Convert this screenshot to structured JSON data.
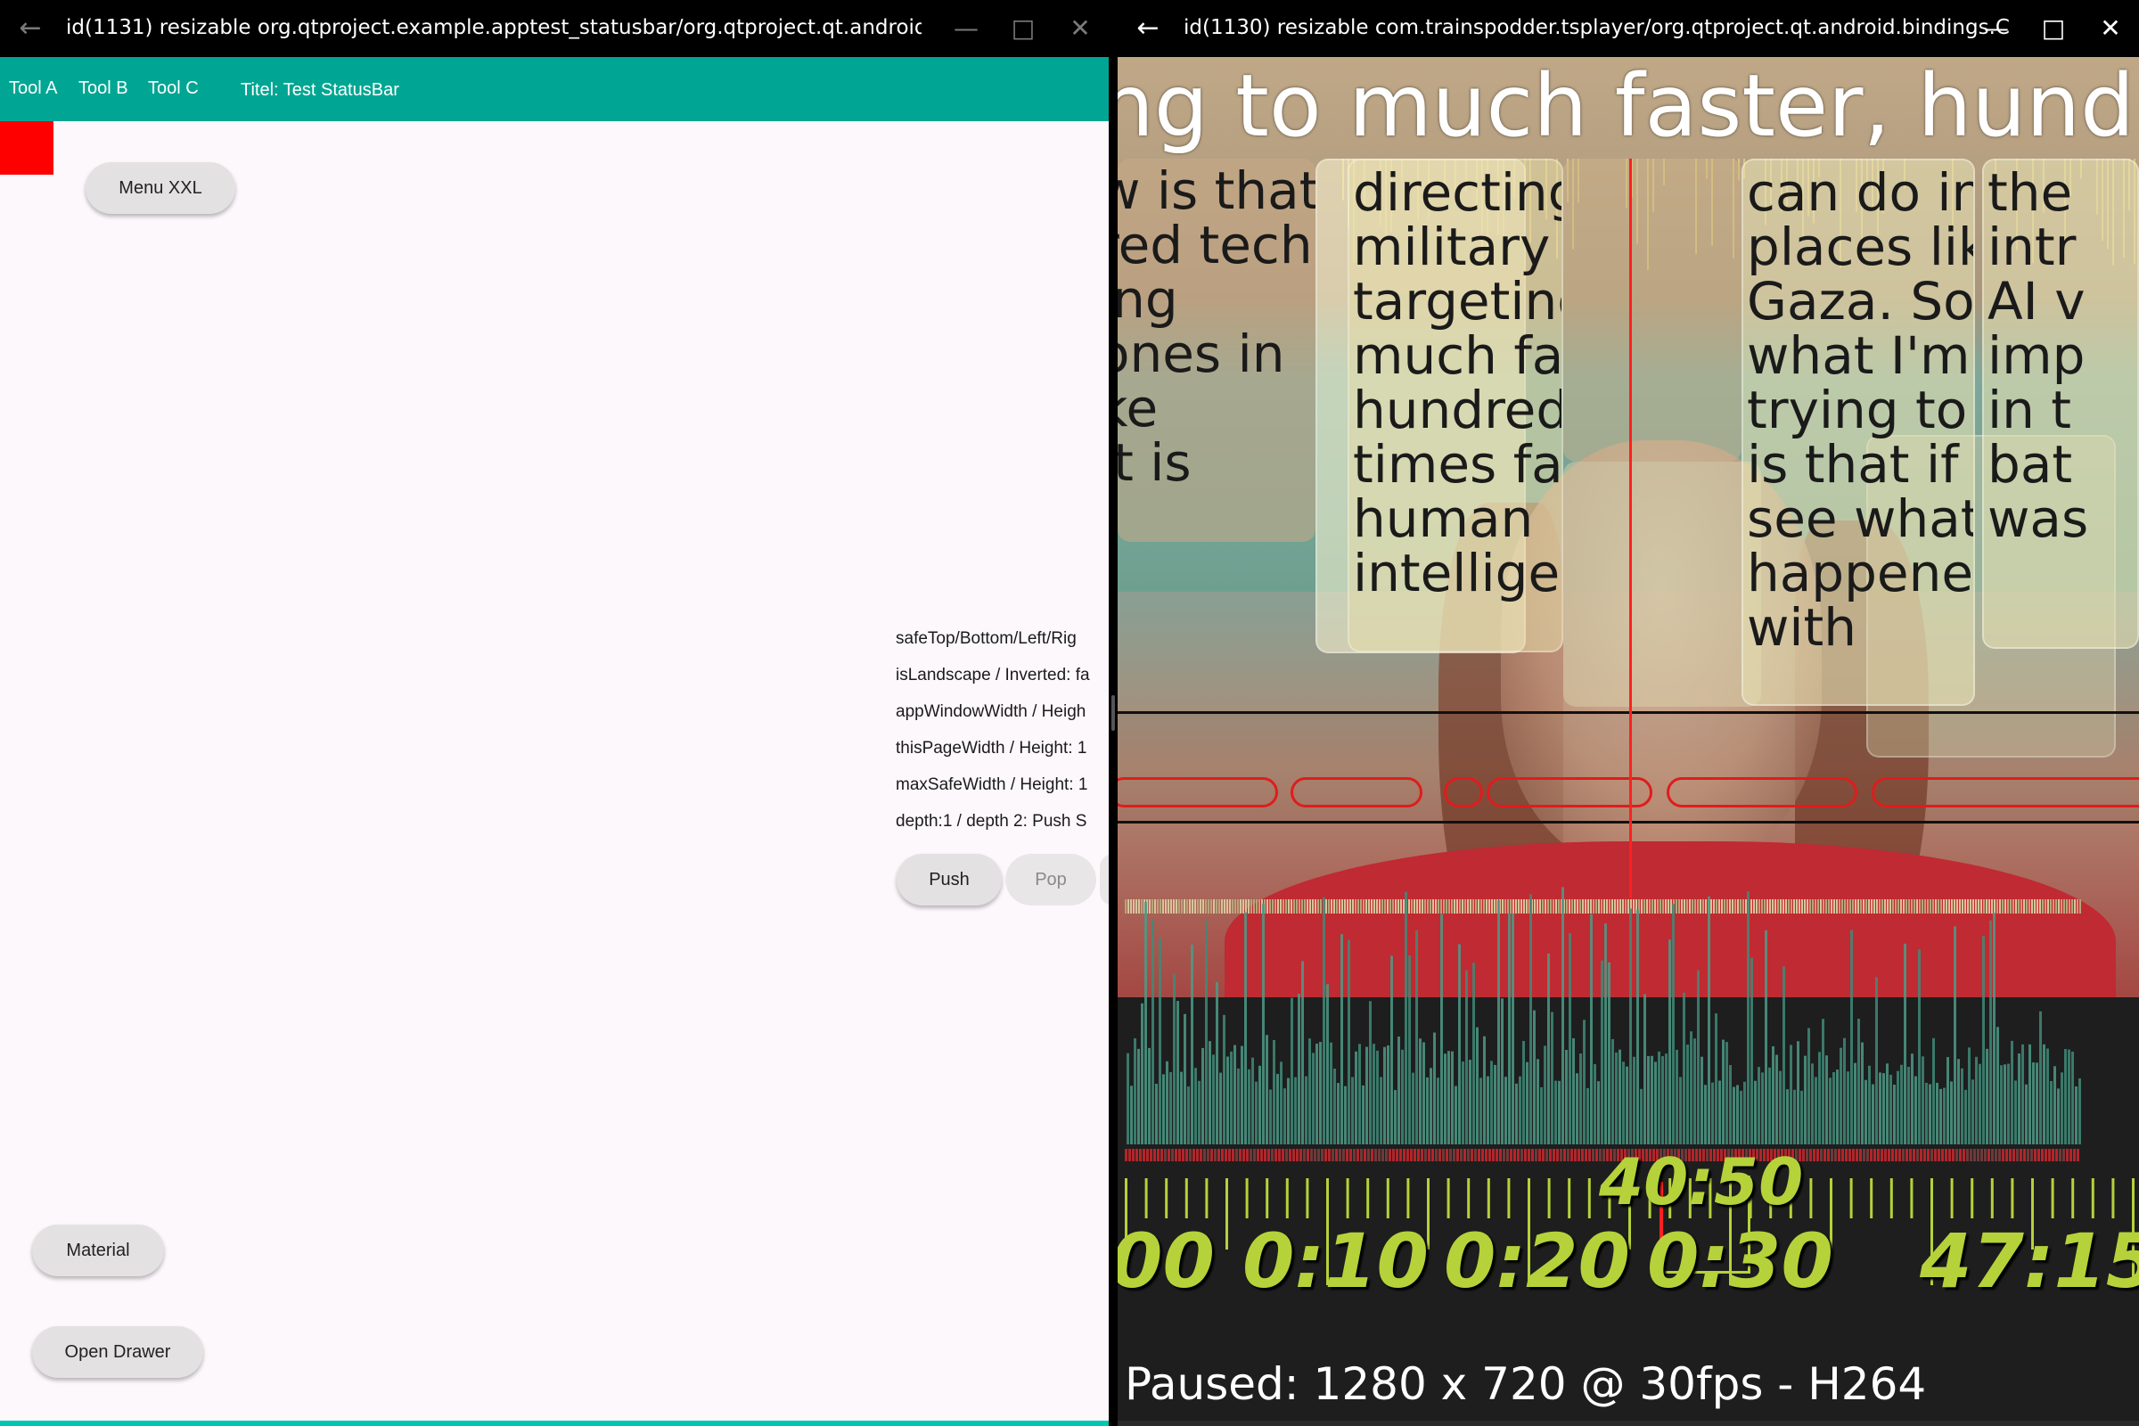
{
  "left_window": {
    "title": "id(1131) resizable org.qtproject.example.apptest_statusbar/org.qtproject.qt.android.bindi",
    "toolbar": {
      "tools": [
        "Tool A",
        "Tool B",
        "Tool C"
      ],
      "title": "Titel: Test StatusBar",
      "color": "#00a693"
    },
    "menu_button": "Menu XXL",
    "info_lines": [
      "safeTop/Bottom/Left/Rig",
      "isLandscape / Inverted: fa",
      "appWindowWidth / Heigh",
      " thisPageWidth / Height: 1",
      "maxSafeWidth / Height: 1",
      "depth:1 / depth 2: Push S"
    ],
    "push_button": "Push",
    "pop_button": "Pop",
    "material_button": "Material",
    "drawer_button": "Open Drawer"
  },
  "right_window": {
    "title": "id(1130) resizable com.trainspodder.tsplayer/org.qtproject.qt.android.bindings.C",
    "subtitle_line": "ng to much faster, hundred",
    "cards": {
      "a": [
        "w is that",
        "red tech",
        "ing",
        "ones in",
        "ke",
        " It is"
      ],
      "c": [
        "directing",
        "military",
        "targeting to",
        "much faster,",
        "hundreds of",
        "times faster than",
        "human",
        "intelligence"
      ],
      "e": [
        "can do in",
        "places like",
        "Gaza. So",
        "what I'm",
        "trying to say",
        "is that if you",
        "see what's",
        "happened",
        "with"
      ],
      "g": [
        "the",
        "intr",
        "AI v",
        "imp",
        "in t",
        "bat",
        "was"
      ]
    },
    "time_labels": [
      "00",
      "0:10",
      "0:20",
      "0:30",
      "47:15"
    ],
    "current_time": "40:50",
    "status": "Paused: 1280 x 720 @ 30fps - H264",
    "accent_color": "#b5d23a",
    "controls": [
      "gear-icon",
      "folder-icon",
      "skip-start-icon",
      "arrow-left-icon",
      "play-icon",
      "stop-icon",
      "arrow-right-icon",
      "skip-end-icon"
    ]
  }
}
